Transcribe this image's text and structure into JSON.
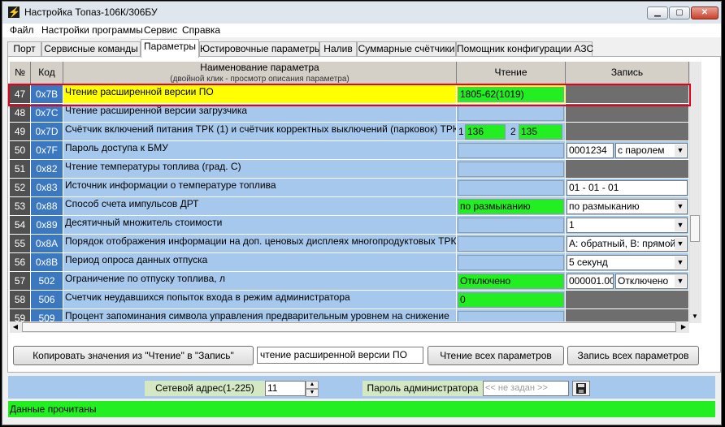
{
  "window": {
    "title": "Настройка Топаз-106К/306БУ"
  },
  "menu": [
    "Файл",
    "Настройки программы",
    "Сервис",
    "Справка"
  ],
  "tabs": [
    {
      "label": "Порт",
      "active": false
    },
    {
      "label": "Сервисные команды",
      "active": false
    },
    {
      "label": "Параметры",
      "active": true
    },
    {
      "label": "Юстировочные параметры",
      "active": false
    },
    {
      "label": "Налив",
      "active": false
    },
    {
      "label": "Суммарные счётчики",
      "active": false
    },
    {
      "label": "Помощник конфигурации АЗС",
      "active": false
    }
  ],
  "grid": {
    "headers": {
      "num": "№",
      "code": "Код",
      "name": "Наименование параметра",
      "name_hint": "(двойной клик - просмотр описания параметра)",
      "read": "Чтение",
      "write": "Запись"
    },
    "rows": [
      {
        "num": "47",
        "code": "0x7B",
        "name": "Чтение расширенной версии ПО",
        "read": {
          "kind": "green",
          "value": "1805-62(1019)"
        },
        "write": {
          "kind": "none"
        },
        "selected": true
      },
      {
        "num": "48",
        "code": "0x7C",
        "name": "Чтение расширенной версии загрузчика",
        "read": {
          "kind": "blue",
          "value": ""
        },
        "write": {
          "kind": "none"
        }
      },
      {
        "num": "49",
        "code": "0x7D",
        "name": "Счётчик включений питания ТРК (1) и счётчик корректных выключений (парковок) ТРК ( 2)",
        "read": {
          "kind": "pair",
          "l1": "1",
          "v1": "136",
          "l2": "2",
          "v2": "135"
        },
        "write": {
          "kind": "none"
        }
      },
      {
        "num": "50",
        "code": "0x7F",
        "name": "Пароль доступа к БМУ",
        "read": {
          "kind": "blue",
          "value": ""
        },
        "write": {
          "kind": "input-select",
          "input": "0001234",
          "select": "с паролем"
        }
      },
      {
        "num": "51",
        "code": "0x82",
        "name": "Чтение температуры топлива (град. С)",
        "read": {
          "kind": "blue",
          "value": ""
        },
        "write": {
          "kind": "none"
        }
      },
      {
        "num": "52",
        "code": "0x83",
        "name": "Источник информации о температуре топлива",
        "read": {
          "kind": "blue",
          "value": ""
        },
        "write": {
          "kind": "input",
          "input": "01 - 01 - 01"
        }
      },
      {
        "num": "53",
        "code": "0x88",
        "name": "Способ счета импульсов ДРТ",
        "read": {
          "kind": "green",
          "value": "по размыканию"
        },
        "write": {
          "kind": "select",
          "select": "по размыканию"
        }
      },
      {
        "num": "54",
        "code": "0x89",
        "name": "Десятичный множитель стоимости",
        "read": {
          "kind": "blue",
          "value": ""
        },
        "write": {
          "kind": "select",
          "select": "1"
        }
      },
      {
        "num": "55",
        "code": "0x8A",
        "name": "Порядок отображения информации на доп. ценовых дисплеях многопродуктовых ТРК",
        "read": {
          "kind": "blue",
          "value": ""
        },
        "write": {
          "kind": "select",
          "select": "А: обратный, В: прямой"
        }
      },
      {
        "num": "56",
        "code": "0x8B",
        "name": "Период опроса данных отпуска",
        "read": {
          "kind": "blue",
          "value": ""
        },
        "write": {
          "kind": "select",
          "select": "5 секунд"
        }
      },
      {
        "num": "57",
        "code": "502",
        "name": "Ограничение по отпуску топлива, л",
        "read": {
          "kind": "green",
          "value": "Отключено"
        },
        "write": {
          "kind": "input-select",
          "input": "000001.00",
          "select": "Отключено"
        }
      },
      {
        "num": "58",
        "code": "506",
        "name": "Счетчик неудавшихся попыток входа в режим администратора",
        "read": {
          "kind": "green",
          "value": "0"
        },
        "write": {
          "kind": "none"
        }
      },
      {
        "num": "59",
        "code": "509",
        "name": "Процент запоминания символа управления предварительным уровнем на снижение",
        "read": {
          "kind": "blue",
          "value": ""
        },
        "write": {
          "kind": "none"
        }
      }
    ]
  },
  "buttons": {
    "copy": "Копировать значения  из \"Чтение\" в \"Запись\"",
    "read_all": "Чтение всех параметров",
    "write_all": "Запись всех параметров"
  },
  "search": {
    "value": "чтение расширенной версии ПО"
  },
  "network": {
    "label": "Сетевой адрес(1-225)",
    "value": "11"
  },
  "admin": {
    "label": "Пароль администратора",
    "placeholder": "<< не задан >>"
  },
  "status": {
    "text": "Данные прочитаны"
  },
  "colors": {
    "green": "#22ee22",
    "blue": "#a6c8ec",
    "highlight": "#ffff00",
    "frame": "#e8001a"
  },
  "icons": [
    "lightning-icon",
    "minimize-icon",
    "maximize-icon",
    "close-icon",
    "save-icon",
    "chevron-down-icon",
    "arrow-up-icon",
    "arrow-down-icon",
    "arrow-left-icon",
    "arrow-right-icon"
  ]
}
